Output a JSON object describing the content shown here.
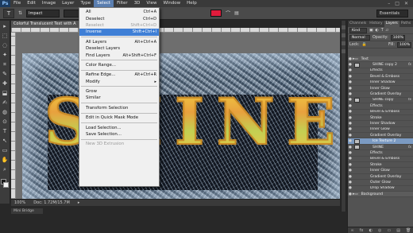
{
  "app": {
    "logo": "Ps"
  },
  "menubar": {
    "items": [
      "File",
      "Edit",
      "Image",
      "Layer",
      "Type",
      "Select",
      "Filter",
      "3D",
      "View",
      "Window",
      "Help"
    ],
    "active_index": 5,
    "window_controls": [
      "–",
      "□",
      "✕"
    ]
  },
  "options_bar": {
    "tool_glyph": "T",
    "font_family": "Impact",
    "essentials": "Essentials",
    "text_color": "#e01c3c"
  },
  "document": {
    "tab_title": "Colorful Translucent Text with A",
    "artwork_text": "SHINE",
    "artwork_letters": [
      "S",
      "H",
      "I",
      "N",
      "E"
    ],
    "zoom": "100%",
    "doc_info": "Doc: 1.72M/15.7M"
  },
  "select_menu": {
    "items": [
      {
        "label": "All",
        "shortcut": "Ctrl+A",
        "state": "normal"
      },
      {
        "label": "Deselect",
        "shortcut": "Ctrl+D",
        "state": "normal"
      },
      {
        "label": "Reselect",
        "shortcut": "Shift+Ctrl+D",
        "state": "disabled"
      },
      {
        "label": "Inverse",
        "shortcut": "Shift+Ctrl+I",
        "state": "highlight"
      },
      {
        "sep": true
      },
      {
        "label": "All Layers",
        "shortcut": "Alt+Ctrl+A",
        "state": "normal"
      },
      {
        "label": "Deselect Layers",
        "shortcut": "",
        "state": "normal"
      },
      {
        "label": "Find Layers",
        "shortcut": "Alt+Shift+Ctrl+F",
        "state": "normal"
      },
      {
        "sep": true
      },
      {
        "label": "Color Range...",
        "shortcut": "",
        "state": "normal"
      },
      {
        "sep": true
      },
      {
        "label": "Refine Edge...",
        "shortcut": "Alt+Ctrl+R",
        "state": "normal"
      },
      {
        "label": "Modify",
        "shortcut": "▸",
        "state": "normal"
      },
      {
        "sep": true
      },
      {
        "label": "Grow",
        "shortcut": "",
        "state": "normal"
      },
      {
        "label": "Similar",
        "shortcut": "",
        "state": "normal"
      },
      {
        "sep": true
      },
      {
        "label": "Transform Selection",
        "shortcut": "",
        "state": "normal"
      },
      {
        "sep": true
      },
      {
        "label": "Edit in Quick Mask Mode",
        "shortcut": "",
        "state": "normal"
      },
      {
        "sep": true
      },
      {
        "label": "Load Selection...",
        "shortcut": "",
        "state": "normal"
      },
      {
        "label": "Save Selection...",
        "shortcut": "",
        "state": "normal"
      },
      {
        "sep": true
      },
      {
        "label": "New 3D Extrusion",
        "shortcut": "",
        "state": "disabled"
      }
    ]
  },
  "layers_panel": {
    "tabs": [
      "Channels",
      "History",
      "Layers",
      "Paths"
    ],
    "active_tab": 2,
    "filter_label": "Kind",
    "blend_mode": "Normal",
    "opacity_label": "Opacity:",
    "opacity_value": "100%",
    "lock_label": "Lock:",
    "fill_label": "Fill:",
    "fill_value": "100%",
    "layers": [
      {
        "name": "Text",
        "level": 1,
        "type": "group",
        "fx": ""
      },
      {
        "name": "SHINE copy 2",
        "level": 2,
        "type": "layer",
        "fx": "fx"
      },
      {
        "name": "Effects",
        "level": 3,
        "type": "effect",
        "fx": ""
      },
      {
        "name": "Bevel & Emboss",
        "level": 3,
        "type": "effect",
        "fx": ""
      },
      {
        "name": "Inner Shadow",
        "level": 3,
        "type": "effect",
        "fx": ""
      },
      {
        "name": "Inner Glow",
        "level": 3,
        "type": "effect",
        "fx": ""
      },
      {
        "name": "Gradient Overlay",
        "level": 3,
        "type": "effect",
        "fx": ""
      },
      {
        "name": "SHINE copy",
        "level": 2,
        "type": "layer",
        "fx": "fx"
      },
      {
        "name": "Effects",
        "level": 3,
        "type": "effect",
        "fx": ""
      },
      {
        "name": "Bevel & Emboss",
        "level": 3,
        "type": "effect",
        "fx": ""
      },
      {
        "name": "Stroke",
        "level": 3,
        "type": "effect",
        "fx": ""
      },
      {
        "name": "Inner Shadow",
        "level": 3,
        "type": "effect",
        "fx": ""
      },
      {
        "name": "Inner Glow",
        "level": 3,
        "type": "effect",
        "fx": ""
      },
      {
        "name": "Gradient Overlay",
        "level": 3,
        "type": "effect",
        "fx": ""
      },
      {
        "name": "Ice Texture 2",
        "level": 2,
        "type": "selected",
        "fx": ""
      },
      {
        "name": "SHINE",
        "level": 2,
        "type": "layer",
        "fx": "fx"
      },
      {
        "name": "Effects",
        "level": 3,
        "type": "effect",
        "fx": ""
      },
      {
        "name": "Bevel & Emboss",
        "level": 3,
        "type": "effect",
        "fx": ""
      },
      {
        "name": "Stroke",
        "level": 3,
        "type": "effect",
        "fx": ""
      },
      {
        "name": "Inner Glow",
        "level": 3,
        "type": "effect",
        "fx": ""
      },
      {
        "name": "Gradient Overlay",
        "level": 3,
        "type": "effect",
        "fx": ""
      },
      {
        "name": "Outer Glow",
        "level": 3,
        "type": "effect",
        "fx": ""
      },
      {
        "name": "Drop Shadow",
        "level": 3,
        "type": "effect",
        "fx": ""
      },
      {
        "name": "Background",
        "level": 1,
        "type": "group",
        "fx": ""
      }
    ],
    "footer_icons": [
      "∞",
      "fx",
      "◐",
      "◎",
      "▭",
      "▤",
      "🗑"
    ]
  },
  "toolbar": {
    "tools": [
      "▸",
      "⬚",
      "◌",
      "✦",
      "⌗",
      "✎",
      "✚",
      "⬓",
      "✍",
      "◍",
      "⊙",
      "T",
      "↖",
      "▭",
      "✋",
      "⌕"
    ]
  },
  "bottom": {
    "tab_label": "Mini Bridge"
  }
}
